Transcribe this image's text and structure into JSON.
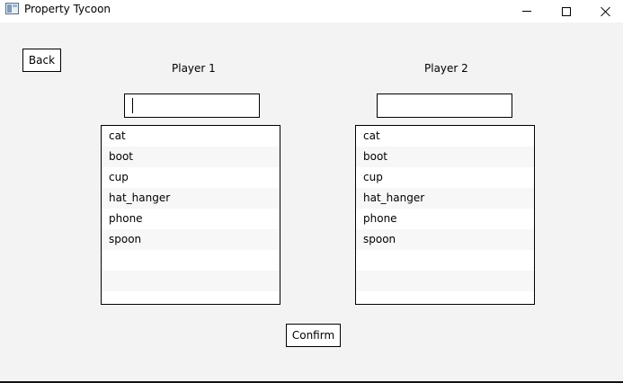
{
  "window": {
    "title": "Property Tycoon"
  },
  "back_label": "Back",
  "confirm_label": "Confirm",
  "players": [
    {
      "label": "Player 1",
      "name_value": "",
      "tokens": [
        "cat",
        "boot",
        "cup",
        "hat_hanger",
        "phone",
        "spoon"
      ]
    },
    {
      "label": "Player 2",
      "name_value": "",
      "tokens": [
        "cat",
        "boot",
        "cup",
        "hat_hanger",
        "phone",
        "spoon"
      ]
    }
  ],
  "icons": {
    "app": "app-window-icon",
    "minimize": "minimize-icon",
    "maximize": "maximize-icon",
    "close": "close-icon"
  }
}
